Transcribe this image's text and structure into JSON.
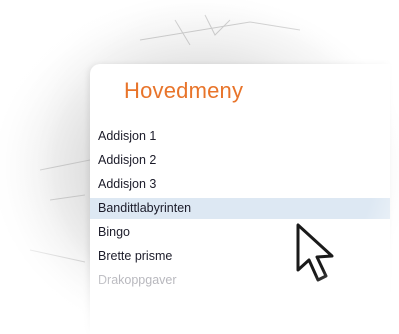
{
  "menu": {
    "title": "Hovedmeny",
    "items": [
      {
        "label": "Addisjon 1"
      },
      {
        "label": "Addisjon 2"
      },
      {
        "label": "Addisjon 3"
      },
      {
        "label": "Bandittlabyrinten"
      },
      {
        "label": "Bingo"
      },
      {
        "label": "Brette prisme"
      },
      {
        "label": "Drakoppgaver"
      }
    ],
    "selected_index": 3
  },
  "colors": {
    "title": "#e8742a",
    "highlight": "#dde8f3",
    "text": "#1c1c2a"
  },
  "icons": [
    "arrow-cursor-icon"
  ]
}
